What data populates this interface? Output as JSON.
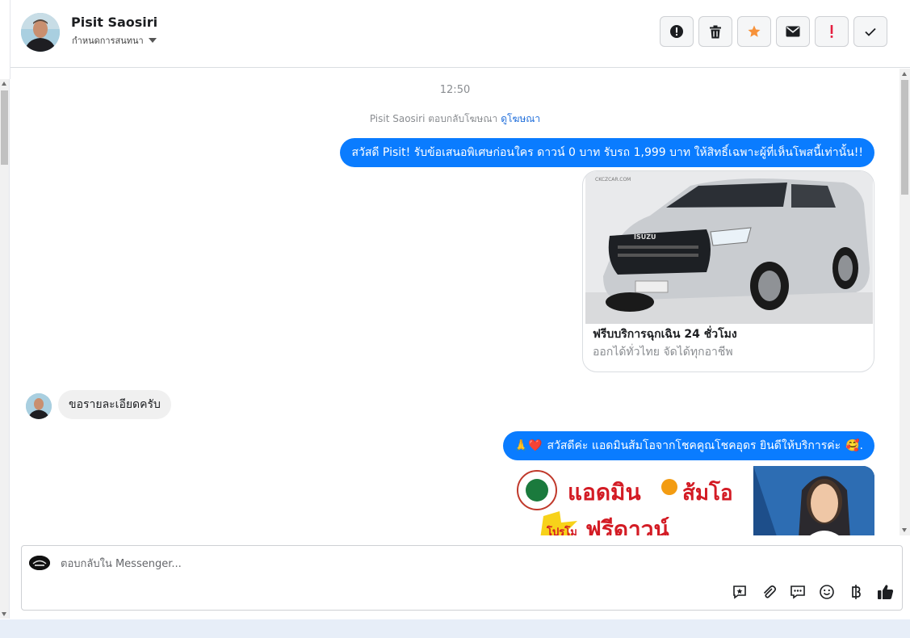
{
  "header": {
    "name": "Pisit Saosiri",
    "assign_label": "กำหนดการสนทนา"
  },
  "thread": {
    "time": "12:50",
    "reply_note": "Pisit Saosiri ตอบกลับโฆษณา",
    "reply_link": "ดูโฆษณา",
    "msg1": "สวัสดี Pisit! รับข้อเสนอพิเศษก่อนใคร ดาวน์ 0 บาท รับรถ 1,999 บาท ให้สิทธิ์เฉพาะผู้ที่เห็นโพสนี้เท่านั้น!!",
    "card_title": "ฟรีบบริการฉุกเฉิน 24 ชั่วโมง",
    "card_sub": "ออกได้ทั่วไทย จัดได้ทุกอาชีพ",
    "card_logo_text": "CKCZCAR.COM",
    "car_brand": "ISUZU",
    "incoming": "ขอรายละเอียดครับ",
    "msg2_prefix": "🙏❤️",
    "msg2": "สวัสดีค่ะ แอดมินส้มโอจากโชคคูณโชคอุดร ยินดีให้บริการค่ะ",
    "msg2_suffix": "🥰.",
    "promo_title": "แอดมิน",
    "promo_name": "ส้มโอ",
    "promo_sub": "ฟรีดาวน์",
    "promo_badge": "โปรโม"
  },
  "composer": {
    "placeholder": "ตอบกลับใน Messenger..."
  },
  "colors": {
    "accent": "#0a7cff",
    "star": "#f7923a",
    "danger": "#e41e3f"
  },
  "icons": {
    "actions": [
      "alert-circle-icon",
      "trash-icon",
      "star-icon",
      "mail-icon",
      "priority-icon",
      "check-icon"
    ],
    "tools": [
      "saved-reply-icon",
      "attachment-icon",
      "chat-icon",
      "emoji-icon",
      "baht-icon",
      "thumbs-up-icon"
    ]
  }
}
